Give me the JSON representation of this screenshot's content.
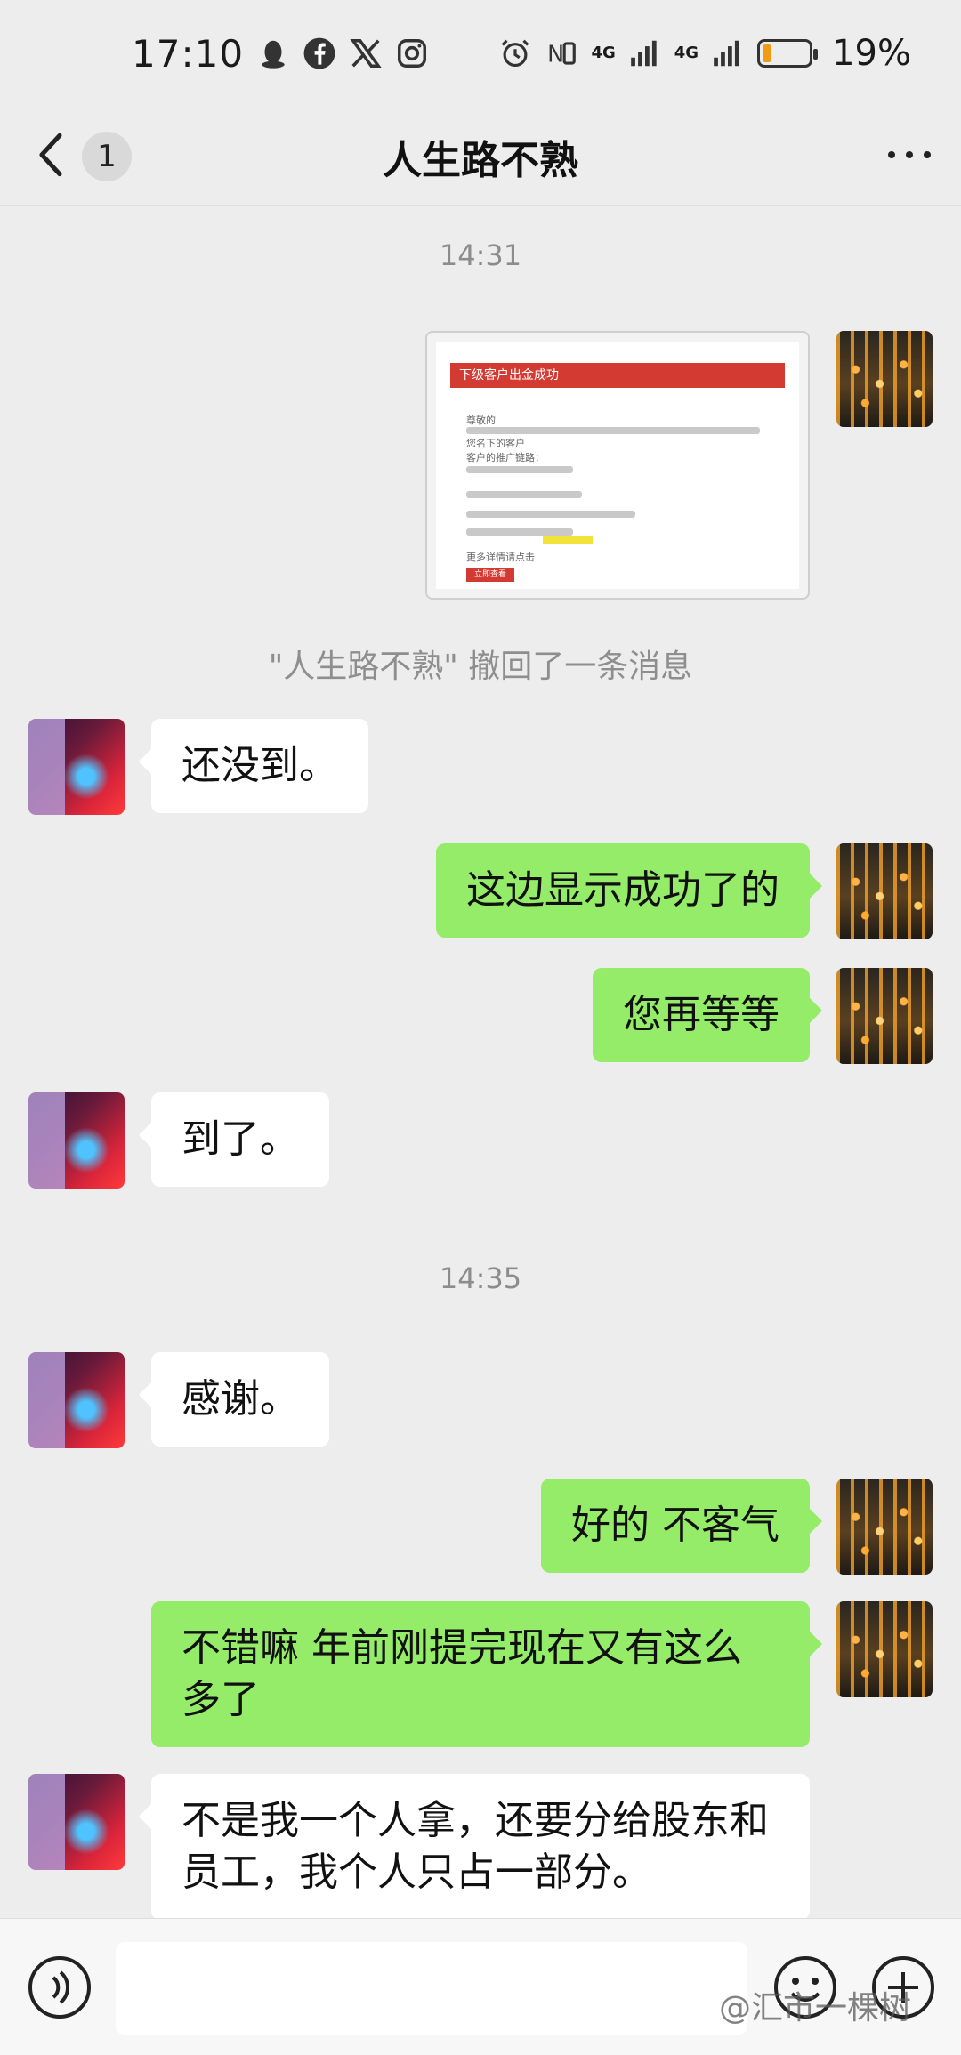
{
  "status_bar": {
    "time": "17:10",
    "network_1": "4G",
    "network_2": "4G",
    "battery_percent": "19%",
    "battery_level": 0.19,
    "battery_color": "#f09a15",
    "icons": [
      "qq-icon",
      "facebook-icon",
      "x-icon",
      "instagram-icon",
      "alarm-icon",
      "nfc-icon",
      "signal-icon",
      "battery-icon"
    ]
  },
  "nav": {
    "unread_count": "1",
    "title": "人生路不熟"
  },
  "messages": {
    "time_1": "14:31",
    "image": {
      "header": "下级客户出金成功",
      "lines": [
        "尊敬的",
        "您名下的客户",
        "客户的推广链路：",
        "",
        "",
        "",
        "",
        "",
        "更多详情请点击",
        "立即查看"
      ]
    },
    "recalled": "\"人生路不熟\" 撤回了一条消息",
    "m1": "还没到。",
    "m2": "这边显示成功了的",
    "m3": "您再等等",
    "m4": "到了。",
    "time_2": "14:35",
    "m5": "感谢。",
    "m6": "好的  不客气",
    "m7": "不错嘛  年前刚提完现在又有这么多了",
    "m8": "不是我一个人拿，还要分给股东和员工，我个人只占一部分。"
  },
  "input": {
    "placeholder": ""
  },
  "watermark": "@汇市一棵树",
  "colors": {
    "background": "#ededed",
    "bubble_self": "#95ec69",
    "bubble_other": "#ffffff"
  }
}
